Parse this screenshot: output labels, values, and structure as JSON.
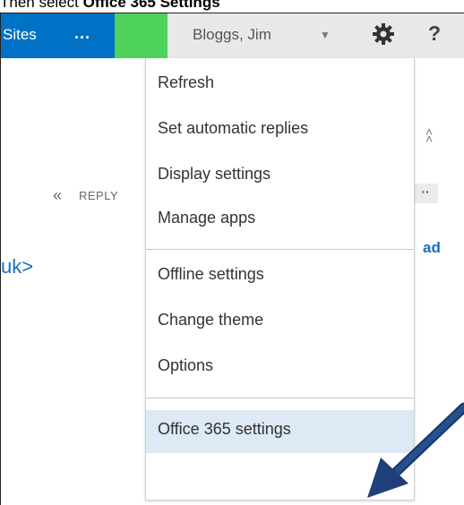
{
  "caption": {
    "prefix": "Then select ",
    "bold": "Office 365 Settings"
  },
  "topbar": {
    "sites_label": "Sites",
    "more_label": "...",
    "user_name": "Bloggs, Jim",
    "user_caret": "▼",
    "help_label": "?"
  },
  "background": {
    "reply_label": "REPLY",
    "reply_icon": "«",
    "more_dots": "··",
    "collapse_glyph": "˄",
    "ad_fragment": "ad",
    "sender_fragment": "uk>"
  },
  "menu": {
    "items": [
      {
        "label": "Refresh"
      },
      {
        "label": "Set automatic replies"
      },
      {
        "label": "Display settings"
      },
      {
        "label": "Manage apps"
      },
      {
        "label": "Offline settings"
      },
      {
        "label": "Change theme"
      },
      {
        "label": "Options"
      },
      {
        "label": "Office 365 settings",
        "selected": true
      }
    ]
  },
  "colors": {
    "accent_blue": "#0072c6",
    "green": "#4fd25a",
    "selected_bg": "#dde9f5",
    "arrow": "#1f3f7a"
  },
  "icons": [
    "gear-icon",
    "help-icon",
    "dropdown-caret-icon",
    "reply-icon",
    "collapse-icon",
    "pointer-arrow-icon"
  ]
}
